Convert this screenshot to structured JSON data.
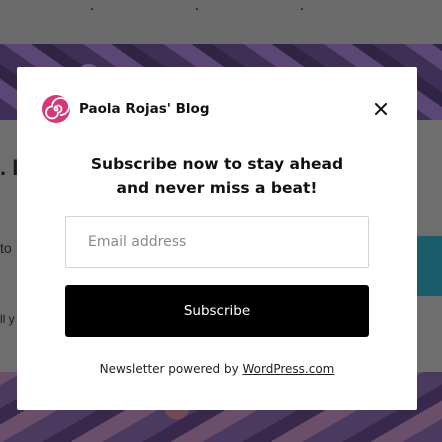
{
  "background": {
    "dots": "· · ·",
    "heading_fragment": ". I",
    "text_fragment_1": "to",
    "text_fragment_2": "ll y"
  },
  "modal": {
    "blog_name": "Paola Rojas' Blog",
    "close_symbol": "×",
    "headline_line1": "Subscribe now to stay ahead",
    "headline_line2": "and never miss a beat!",
    "email_placeholder": "Email address",
    "email_value": "",
    "subscribe_label": "Subscribe",
    "footer_prefix": "Newsletter powered by ",
    "footer_link": "WordPress.com"
  },
  "colors": {
    "logo_pink": "#d6377a",
    "button_bg": "#000000",
    "modal_bg": "#ffffff"
  },
  "icons": {
    "logo": "spiral-logo-icon",
    "close": "close-icon"
  }
}
